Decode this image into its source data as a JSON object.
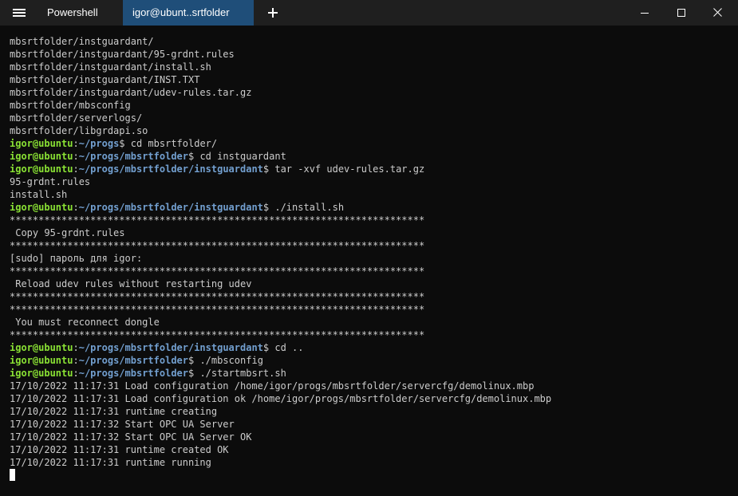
{
  "window": {
    "tabs": [
      {
        "label": "Powershell",
        "active": false
      },
      {
        "label": "igor@ubunt..srtfolder",
        "active": true
      }
    ],
    "icons": {
      "menu": "hamburger-menu-icon",
      "new_tab": "plus-icon",
      "minimize": "minimize-icon",
      "maximize": "maximize-icon",
      "close": "close-icon"
    }
  },
  "colors": {
    "background": "#0c0c0c",
    "titlebar": "#1f1f1f",
    "active_tab": "#1f4e79",
    "text": "#cccccc",
    "prompt_user": "#8ae234",
    "prompt_path": "#729fcf"
  },
  "terminal": {
    "lines": [
      [
        {
          "t": "mbsrtfolder/instguardant/",
          "c": "text"
        }
      ],
      [
        {
          "t": "mbsrtfolder/instguardant/95-grdnt.rules",
          "c": "text"
        }
      ],
      [
        {
          "t": "mbsrtfolder/instguardant/install.sh",
          "c": "text"
        }
      ],
      [
        {
          "t": "mbsrtfolder/instguardant/INST.TXT",
          "c": "text"
        }
      ],
      [
        {
          "t": "mbsrtfolder/instguardant/udev-rules.tar.gz",
          "c": "text"
        }
      ],
      [
        {
          "t": "mbsrtfolder/mbsconfig",
          "c": "text"
        }
      ],
      [
        {
          "t": "mbsrtfolder/serverlogs/",
          "c": "text"
        }
      ],
      [
        {
          "t": "mbsrtfolder/libgrdapi.so",
          "c": "text"
        }
      ],
      [
        {
          "t": "igor@ubuntu",
          "c": "user"
        },
        {
          "t": ":",
          "c": "text"
        },
        {
          "t": "~/progs",
          "c": "path"
        },
        {
          "t": "$ cd mbsrtfolder/",
          "c": "text"
        }
      ],
      [
        {
          "t": "igor@ubuntu",
          "c": "user"
        },
        {
          "t": ":",
          "c": "text"
        },
        {
          "t": "~/progs/mbsrtfolder",
          "c": "path"
        },
        {
          "t": "$ cd instguardant",
          "c": "text"
        }
      ],
      [
        {
          "t": "igor@ubuntu",
          "c": "user"
        },
        {
          "t": ":",
          "c": "text"
        },
        {
          "t": "~/progs/mbsrtfolder/instguardant",
          "c": "path"
        },
        {
          "t": "$ tar -xvf udev-rules.tar.gz",
          "c": "text"
        }
      ],
      [
        {
          "t": "95-grdnt.rules",
          "c": "text"
        }
      ],
      [
        {
          "t": "install.sh",
          "c": "text"
        }
      ],
      [
        {
          "t": "igor@ubuntu",
          "c": "user"
        },
        {
          "t": ":",
          "c": "text"
        },
        {
          "t": "~/progs/mbsrtfolder/instguardant",
          "c": "path"
        },
        {
          "t": "$ ./install.sh",
          "c": "text"
        }
      ],
      [
        {
          "t": "************************************************************************",
          "c": "text"
        }
      ],
      [
        {
          "t": " Copy 95-grdnt.rules",
          "c": "text"
        }
      ],
      [
        {
          "t": "************************************************************************",
          "c": "text"
        }
      ],
      [
        {
          "t": "[sudo] пароль для igor:",
          "c": "text"
        }
      ],
      [
        {
          "t": "************************************************************************",
          "c": "text"
        }
      ],
      [
        {
          "t": " Reload udev rules without restarting udev",
          "c": "text"
        }
      ],
      [
        {
          "t": "************************************************************************",
          "c": "text"
        }
      ],
      [
        {
          "t": "************************************************************************",
          "c": "text"
        }
      ],
      [
        {
          "t": " You must reconnect dongle",
          "c": "text"
        }
      ],
      [
        {
          "t": "************************************************************************",
          "c": "text"
        }
      ],
      [
        {
          "t": "igor@ubuntu",
          "c": "user"
        },
        {
          "t": ":",
          "c": "text"
        },
        {
          "t": "~/progs/mbsrtfolder/instguardant",
          "c": "path"
        },
        {
          "t": "$ cd ..",
          "c": "text"
        }
      ],
      [
        {
          "t": "igor@ubuntu",
          "c": "user"
        },
        {
          "t": ":",
          "c": "text"
        },
        {
          "t": "~/progs/mbsrtfolder",
          "c": "path"
        },
        {
          "t": "$ ./mbsconfig",
          "c": "text"
        }
      ],
      [
        {
          "t": "igor@ubuntu",
          "c": "user"
        },
        {
          "t": ":",
          "c": "text"
        },
        {
          "t": "~/progs/mbsrtfolder",
          "c": "path"
        },
        {
          "t": "$ ./startmbsrt.sh",
          "c": "text"
        }
      ],
      [
        {
          "t": "17/10/2022 11:17:31 Load configuration /home/igor/progs/mbsrtfolder/servercfg/demolinux.mbp",
          "c": "text"
        }
      ],
      [
        {
          "t": "17/10/2022 11:17:31 Load configuration ok /home/igor/progs/mbsrtfolder/servercfg/demolinux.mbp",
          "c": "text"
        }
      ],
      [
        {
          "t": "17/10/2022 11:17:31 runtime creating",
          "c": "text"
        }
      ],
      [
        {
          "t": "17/10/2022 11:17:32 Start OPC UA Server",
          "c": "text"
        }
      ],
      [
        {
          "t": "17/10/2022 11:17:32 Start OPC UA Server OK",
          "c": "text"
        }
      ],
      [
        {
          "t": "17/10/2022 11:17:31 runtime created OK",
          "c": "text"
        }
      ],
      [
        {
          "t": "17/10/2022 11:17:31 runtime running",
          "c": "text"
        }
      ]
    ]
  }
}
